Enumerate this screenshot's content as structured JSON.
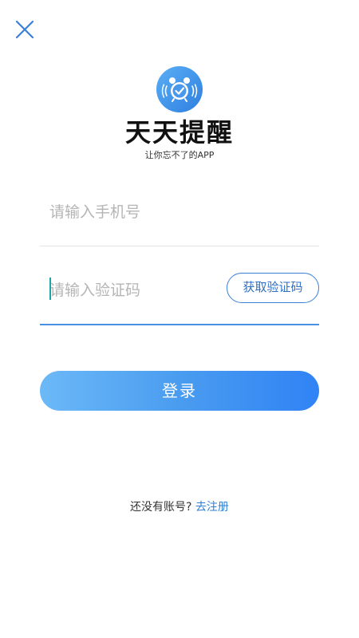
{
  "header": {
    "close_icon": "close-icon"
  },
  "brand": {
    "logo_icon": "alarm-clock-icon",
    "app_name": "天天提醒",
    "slogan": "让你忘不了的APP"
  },
  "form": {
    "phone": {
      "placeholder": "请输入手机号",
      "value": ""
    },
    "code": {
      "placeholder": "请输入验证码",
      "value": "",
      "get_code_label": "获取验证码"
    },
    "login_label": "登录"
  },
  "footer": {
    "no_account_text": "还没有账号?",
    "register_link": "去注册"
  },
  "colors": {
    "accent": "#3a7fd8",
    "link": "#2f7fd6",
    "button_gradient_start": "#6cb9f7",
    "button_gradient_end": "#3083f4",
    "caret": "#1aa6a6"
  }
}
